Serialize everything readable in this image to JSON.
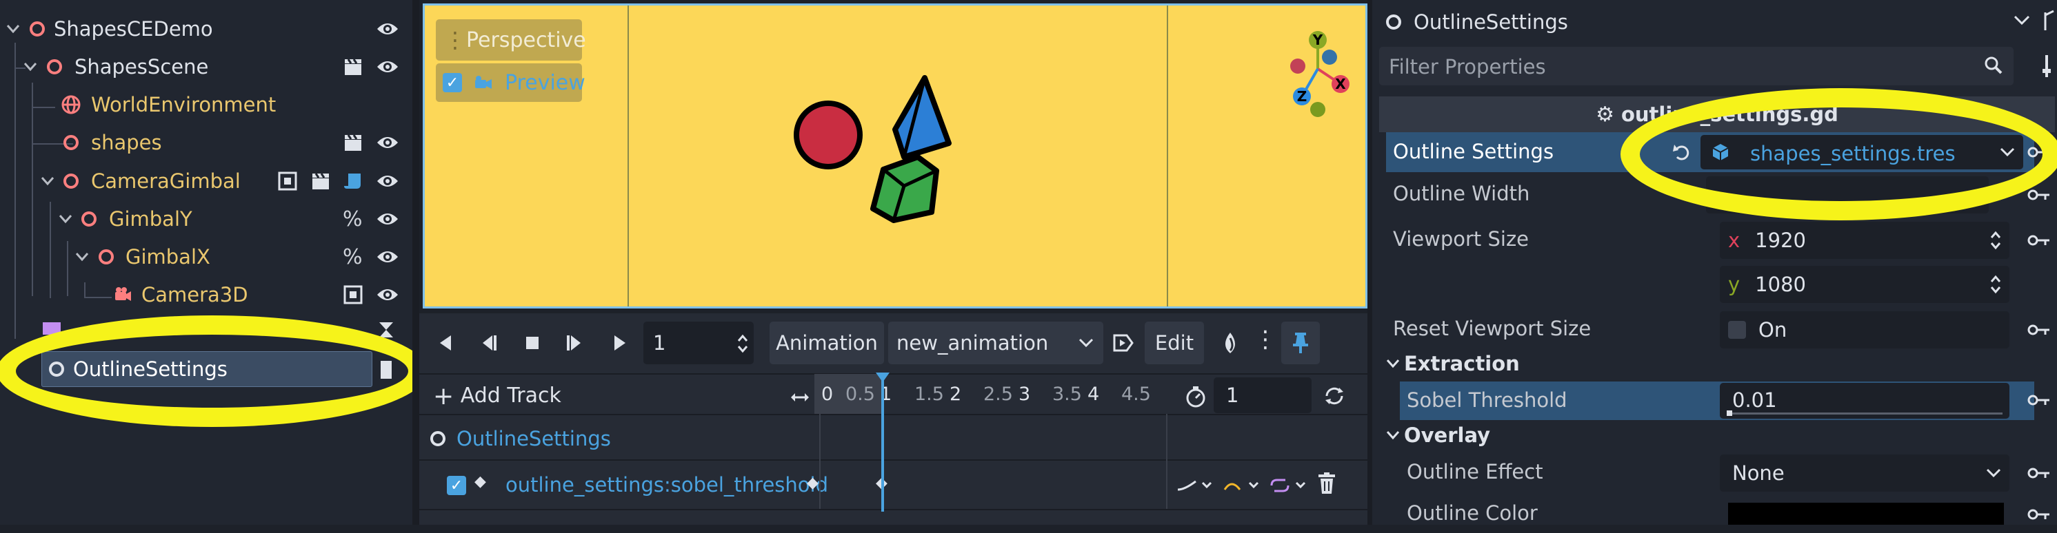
{
  "scene_tree": {
    "nodes": [
      {
        "name": "ShapesCEDemo",
        "type": "node"
      },
      {
        "name": "ShapesScene",
        "type": "node"
      },
      {
        "name": "WorldEnvironment",
        "type": "world-environment"
      },
      {
        "name": "shapes",
        "type": "node"
      },
      {
        "name": "CameraGimbal",
        "type": "node"
      },
      {
        "name": "GimbalY",
        "type": "node"
      },
      {
        "name": "GimbalX",
        "type": "node"
      },
      {
        "name": "Camera3D",
        "type": "camera"
      },
      {
        "name": "OutlineSettings",
        "type": "node",
        "selected": true
      }
    ],
    "percent_symbol": "%"
  },
  "viewport": {
    "perspective_label": "Perspective",
    "preview_label": "Preview",
    "preview_checked": true,
    "gizmo_axes": [
      "Y",
      "X",
      "Z"
    ]
  },
  "animation": {
    "frame_value": "1",
    "animation_label": "Animation",
    "animation_name": "new_animation",
    "edit_label": "Edit",
    "add_track_label": "Add Track",
    "ruler_ticks": [
      "0",
      "0.5",
      "1",
      "1.5",
      "2",
      "2.5",
      "3",
      "3.5",
      "4",
      "4.5"
    ],
    "length_value": "1",
    "track_group": "OutlineSettings",
    "track_name": "outline_settings:sobel_threshold",
    "track_enabled": true
  },
  "inspector": {
    "object_name": "OutlineSettings",
    "filter_placeholder": "Filter Properties",
    "section_title": "outline_settings.gd",
    "outline_settings_label": "Outline Settings",
    "outline_settings_value": "shapes_settings.tres",
    "outline_width_label": "Outline Width",
    "viewport_size_label": "Viewport Size",
    "viewport_x_label": "x",
    "viewport_x": "1920",
    "viewport_y_label": "y",
    "viewport_y": "1080",
    "reset_viewport_label": "Reset Viewport Size",
    "reset_viewport_value": "On",
    "extraction_label": "Extraction",
    "sobel_label": "Sobel Threshold",
    "sobel_value": "0.01",
    "overlay_label": "Overlay",
    "outline_effect_label": "Outline Effect",
    "outline_effect_value": "None",
    "outline_color_label": "Outline Color"
  },
  "colors": {
    "accent": "#4aa3e0",
    "node_red": "#fc7f7f",
    "node_yellow": "#eac76e",
    "viewport_bg": "#fcd758",
    "highlight": "#f6f31a"
  }
}
